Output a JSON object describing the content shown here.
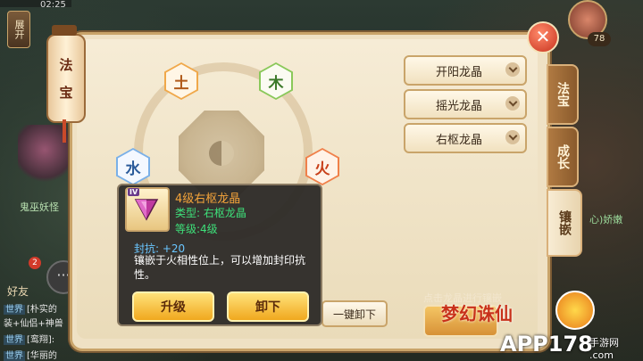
{
  "status": {
    "time": "02:25"
  },
  "hud": {
    "expand_label": "展开",
    "player_level": "78",
    "monster_label": "鬼巫妖怪",
    "friend_badge": "2",
    "friend_label": "好友",
    "right_label": "心)娇嫩"
  },
  "lantern": {
    "line1": "法",
    "line2": "宝"
  },
  "panel": {
    "close_label": "✕",
    "elements": {
      "top_left": "土",
      "top_right": "木",
      "left": "水",
      "right": "火"
    },
    "slots": [
      {
        "label": "开阳龙晶"
      },
      {
        "label": "摇光龙晶"
      },
      {
        "label": "右枢龙晶"
      }
    ],
    "hint": "点击龙晶进行镶嵌",
    "unload_all_label": "一键卸下"
  },
  "tabs": [
    {
      "label": "法宝",
      "active": false
    },
    {
      "label": "成长",
      "active": false
    },
    {
      "label": "镶嵌",
      "active": true
    }
  ],
  "tooltip": {
    "level_badge": "IV",
    "title": "4级右枢龙晶",
    "type": "类型: 右枢龙晶",
    "level": "等级:4级",
    "stat": "封抗: +20",
    "desc": "镶嵌于火相性位上，可以增加封印抗性。",
    "upgrade_label": "升级",
    "remove_label": "卸下"
  },
  "chat": [
    {
      "tag": "世界",
      "text": "[朴实的"
    },
    {
      "tag": "",
      "text": "装+仙侣+神兽"
    },
    {
      "tag": "世界",
      "text": "[鸾翔]:"
    },
    {
      "tag": "世界",
      "text": "[华丽的"
    }
  ],
  "watermark": {
    "app": "APP178",
    "site": "手游网",
    "site2": ".com",
    "game": "梦幻诛仙"
  },
  "colors": {
    "accent": "#c9a46a",
    "title_orange": "#f5a43a",
    "type_green": "#3ee07a",
    "stat_blue": "#6ac6ff"
  }
}
